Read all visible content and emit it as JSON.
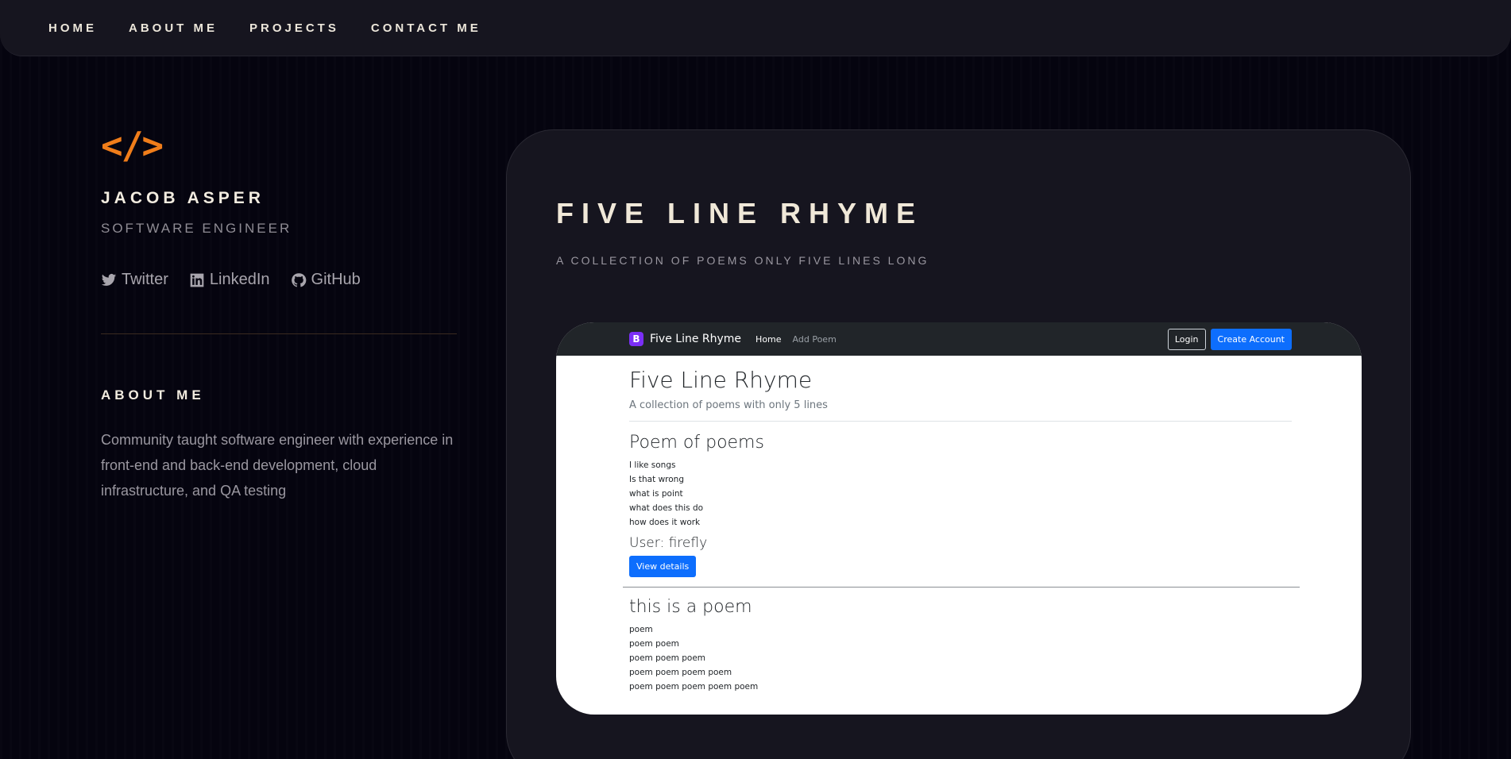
{
  "nav": {
    "items": [
      "HOME",
      "ABOUT ME",
      "PROJECTS",
      "CONTACT ME"
    ]
  },
  "profile": {
    "logo": "</>",
    "name": "JACOB ASPER",
    "role": "SOFTWARE ENGINEER",
    "socials": [
      {
        "label": "Twitter",
        "icon": "twitter-icon"
      },
      {
        "label": "LinkedIn",
        "icon": "linkedin-icon"
      },
      {
        "label": "GitHub",
        "icon": "github-icon"
      }
    ],
    "about_heading": "ABOUT ME",
    "about_text": "Community taught software engineer with experience in front-end and back-end development, cloud infrastructure, and QA testing"
  },
  "project": {
    "title": "FIVE LINE RHYME",
    "subtitle": "A COLLECTION OF POEMS ONLY FIVE LINES LONG",
    "screenshot": {
      "brand_icon": "B",
      "brand": "Five Line Rhyme",
      "nav_home": "Home",
      "nav_add": "Add Poem",
      "login": "Login",
      "create_account": "Create Account",
      "heading": "Five Line Rhyme",
      "tagline": "A collection of poems with only 5 lines",
      "poems": [
        {
          "title": "Poem of poems",
          "lines": [
            "I like songs",
            "Is that wrong",
            "what is point",
            "what does this do",
            "how does it work"
          ],
          "user": "User: firefly",
          "button": "View details"
        },
        {
          "title": "this is a poem",
          "lines": [
            "poem",
            "poem poem",
            "poem poem poem",
            "poem poem poem poem",
            "poem poem poem poem poem"
          ]
        }
      ]
    }
  },
  "colors": {
    "accent": "#f07d1a",
    "background": "#05040f",
    "card": "#16151f",
    "primary_button": "#0d6efd"
  }
}
